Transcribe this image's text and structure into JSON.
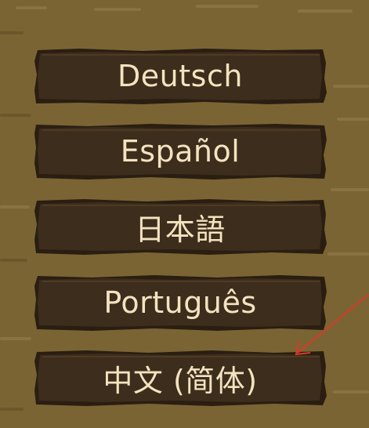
{
  "languages": [
    {
      "label": "Deutsch"
    },
    {
      "label": "Español"
    },
    {
      "label": "日本語"
    },
    {
      "label": "Português"
    },
    {
      "label": "中文 (简体)"
    }
  ],
  "colors": {
    "background": "#7a6433",
    "plank_fill": "#3d2d1c",
    "plank_edge": "#2a1e12",
    "plank_highlight": "#6b5536",
    "label_text": "#f4e3c0",
    "annotation_arrow": "#d83a2a"
  }
}
